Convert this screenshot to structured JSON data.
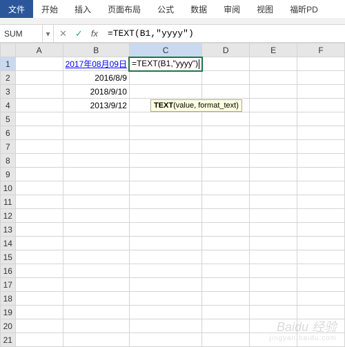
{
  "ribbon": {
    "tabs": [
      "文件",
      "开始",
      "插入",
      "页面布局",
      "公式",
      "数据",
      "审阅",
      "视图",
      "福昕PD"
    ],
    "active_index": 0
  },
  "formula_bar": {
    "name_box": "SUM",
    "dropdown_glyph": "▾",
    "cancel_glyph": "✕",
    "confirm_glyph": "✓",
    "fx_label": "fx",
    "formula": "=TEXT(B1,\"yyyy\")"
  },
  "columns": [
    "A",
    "B",
    "C",
    "D",
    "E",
    "F"
  ],
  "active_col": "C",
  "active_row": 1,
  "row_count": 21,
  "cells": {
    "B1": "2017年08月09日",
    "B2": "2016/8/9",
    "B3": "2018/9/10",
    "B4": "2013/9/12",
    "C1": "=TEXT(B1,\"yyyy\")"
  },
  "editing_cell": "C1",
  "tooltip": {
    "fn": "TEXT",
    "sig": "(value, format_text)"
  },
  "watermark": {
    "main": "Baidu 经验",
    "sub": "jingyan.baidu.com"
  }
}
